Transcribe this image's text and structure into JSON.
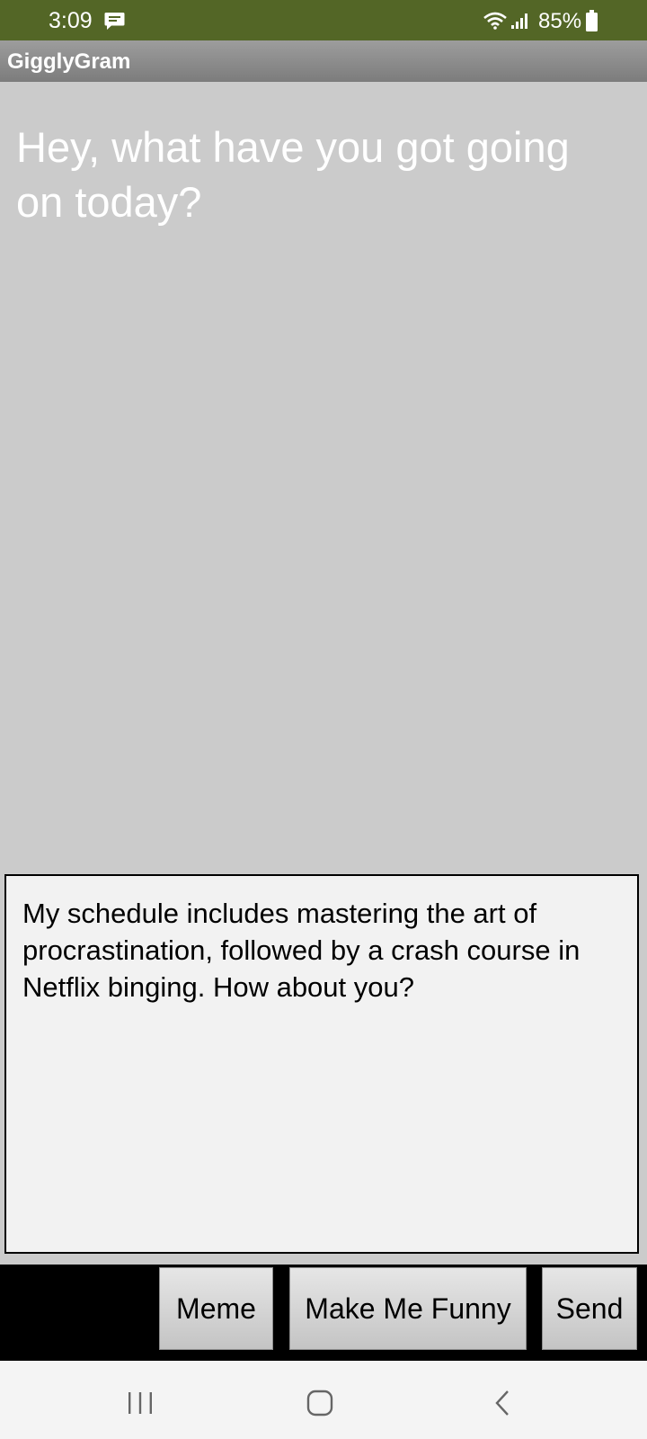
{
  "status_bar": {
    "time": "3:09",
    "battery": "85%",
    "icons": [
      "message-icon",
      "wifi-icon",
      "signal-icon",
      "battery-icon"
    ]
  },
  "app_bar": {
    "title": "GigglyGram"
  },
  "prompt": {
    "text": "Hey, what have you got going on today?"
  },
  "reply": {
    "text": "My schedule includes mastering the art of procrastination, followed by a crash course in Netflix binging. How about you?"
  },
  "buttons": {
    "meme": "Meme",
    "make_me_funny": "Make Me Funny",
    "send": "Send"
  },
  "nav_bar": {
    "icons": [
      "recents-icon",
      "home-icon",
      "back-icon"
    ]
  },
  "colors": {
    "status_bar": "#536626",
    "app_bar": "#8a8a8a",
    "background": "#cbcbcb",
    "reply_box": "#f2f2f2",
    "button_bar": "#000000",
    "nav_bar": "#f4f4f4"
  }
}
